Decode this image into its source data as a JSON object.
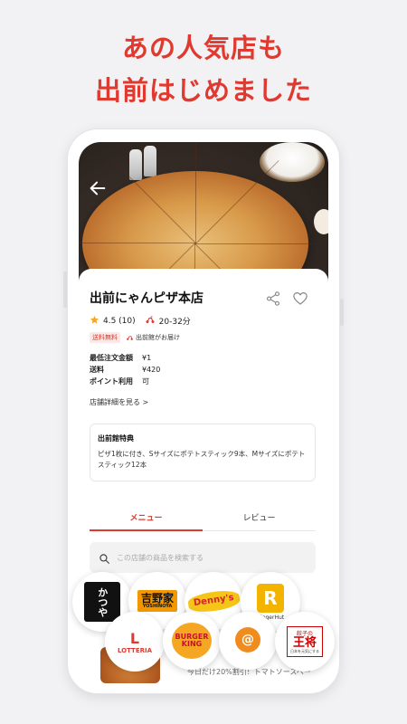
{
  "headline": {
    "line1": "あの人気店も",
    "line2": "出前はじめました"
  },
  "store": {
    "name": "出前にゃんピザ本店",
    "rating": "4.5 (10)",
    "delivery_time": "20-32分",
    "badge_free_shipping": "送料無料",
    "delivered_by": "出前館がお届け",
    "min_order_label": "最低注文金額",
    "min_order_value": "¥1",
    "shipping_label": "送料",
    "shipping_value": "¥420",
    "points_label": "ポイント利用",
    "points_value": "可",
    "details_link": "店舗詳細を見る >"
  },
  "benefit": {
    "title": "出前館特典",
    "body": "ピザ1枚に付き、Sサイズにポテトスティック9本、Mサイズにポテトスティック12本"
  },
  "tabs": [
    {
      "label": "メニュー",
      "active": true
    },
    {
      "label": "レビュー",
      "active": false
    }
  ],
  "search": {
    "placeholder": "この店舗の商品を検索する"
  },
  "promo_text": "今日だけ20%割引！トマトソースベー",
  "brand_logos": {
    "katsuya": "かつや",
    "yoshinoya": "吉野家",
    "yoshinoya_sub": "YOSHINOYA",
    "dennys": "Denny's",
    "ringerhut": "RingerHut",
    "lotteria": "LOTTERIA",
    "burgerking_1": "BURGER",
    "burgerking_2": "KING",
    "hamazushi": "はなまる",
    "ohsho": "王将",
    "ohsho_sub": "日本を元気にする",
    "ohsho_top": "餃子の"
  },
  "colors": {
    "accent": "#e03a30",
    "background": "#f2f2f4"
  }
}
